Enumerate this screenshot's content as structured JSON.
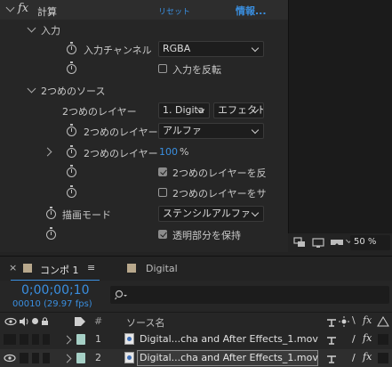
{
  "effect": {
    "name": "計算",
    "reset": "リセット",
    "info": "情報...",
    "fx_icon": "fx"
  },
  "input_group": {
    "label": "入力",
    "channel_label": "入力チャンネル",
    "channel_value": "RGBA",
    "invert_label": "入力を反転"
  },
  "second_source": {
    "label": "2つめのソース",
    "layer_label": "2つめのレイヤー",
    "layer_value": "1. Digita",
    "layer_effect_value": "エフェクト",
    "channel_label": "2つめのレイヤー",
    "channel_value": "アルファ",
    "opacity_label": "2つめのレイヤー",
    "opacity_value": "100",
    "opacity_unit": "%",
    "invert_label": "2つめのレイヤーを反",
    "stretch_label": "2つめのレイヤーをサ"
  },
  "blend": {
    "label": "描画モード",
    "value": "ステンシルアルファ"
  },
  "preserve": {
    "label": "透明部分を保持"
  },
  "viewer": {
    "zoom": "50 %"
  },
  "tabs": {
    "comp_tab": "コンポ 1",
    "comp_menu": "≡",
    "close": "×",
    "footage_tab": "Digital"
  },
  "timeline": {
    "timecode": "0;00;00;10",
    "frame_info": "00010 (29.97 fps)",
    "search_placeholder": "",
    "col_hash": "#",
    "col_source": "ソース名",
    "layers": [
      {
        "index": "1",
        "name": "Digital...cha and After Effects_1.mov",
        "switch": "/",
        "fx": "fx",
        "color": "#a6d0c6"
      },
      {
        "index": "2",
        "name": "Digital...cha and After Effects_1.mov",
        "switch": "/",
        "fx": "fx",
        "color": "#a6d0c6"
      }
    ]
  },
  "colors": {
    "accent_blue": "#3a8fe0",
    "label_aqua": "#a6d0c6"
  }
}
